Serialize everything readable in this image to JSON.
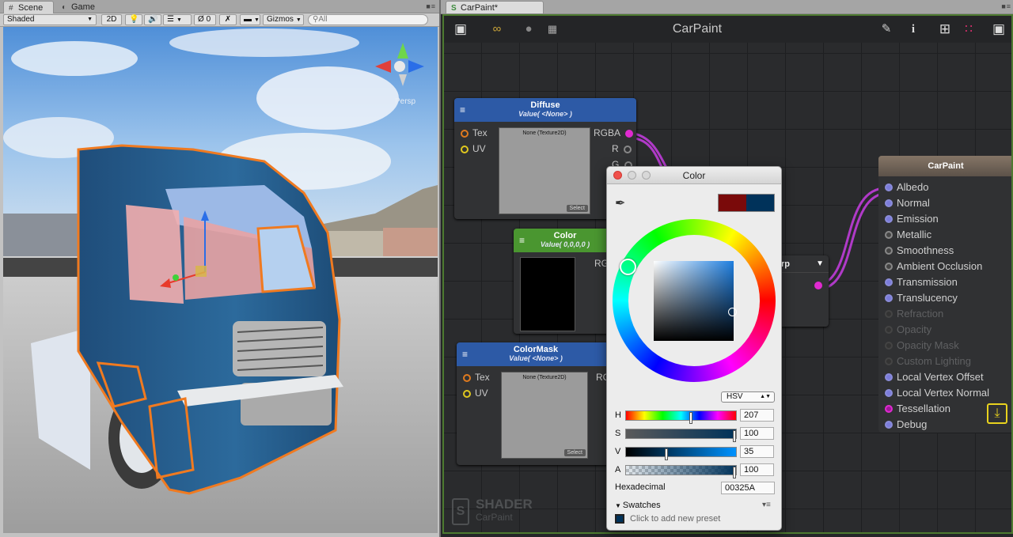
{
  "scene_window": {
    "tabs": [
      {
        "label": "Scene",
        "icon": "grid-icon"
      },
      {
        "label": "Game",
        "icon": "pacman-icon"
      }
    ],
    "toolbar": {
      "shading_mode": "Shaded",
      "mode_2d": "2D",
      "hidden_count": "0",
      "gizmos_label": "Gizmos",
      "search_placeholder": "All"
    },
    "gizmo_label": "Persp"
  },
  "shader_window": {
    "tab_label": "CarPaint*",
    "canvas_title": "CarPaint",
    "nodes": {
      "diffuse": {
        "title": "Diffuse",
        "subtitle": "Value( <None> )",
        "inputs": [
          "Tex",
          "UV"
        ],
        "outputs": [
          "RGBA",
          "R",
          "G"
        ],
        "preview_caption": "None (Texture2D)",
        "select_label": "Select"
      },
      "color": {
        "title": "Color",
        "subtitle": "Value( 0,0,0,0 )",
        "output_partial": "RGB"
      },
      "colormask": {
        "title": "ColorMask",
        "subtitle": "Value( <None> )",
        "inputs": [
          "Tex",
          "UV"
        ],
        "output_partial": "RG",
        "preview_caption": "None (Texture2D)",
        "select_label": "Select"
      },
      "hidden_node_partial_title": "rp"
    },
    "output_node": {
      "title": "CarPaint",
      "inputs": [
        {
          "label": "Albedo",
          "active": true,
          "color": "#7b7cdb"
        },
        {
          "label": "Normal",
          "active": true,
          "color": "#7b7cdb"
        },
        {
          "label": "Emission",
          "active": true,
          "color": "#7b7cdb"
        },
        {
          "label": "Metallic",
          "active": true,
          "color": "#6b6b6b"
        },
        {
          "label": "Smoothness",
          "active": true,
          "color": "#6b6b6b"
        },
        {
          "label": "Ambient Occlusion",
          "active": true,
          "color": "#6b6b6b"
        },
        {
          "label": "Transmission",
          "active": true,
          "color": "#7b7cdb"
        },
        {
          "label": "Translucency",
          "active": true,
          "color": "#7b7cdb"
        },
        {
          "label": "Refraction",
          "active": false,
          "color": "#4a4a4a"
        },
        {
          "label": "Opacity",
          "active": false,
          "color": "#4a4a4a"
        },
        {
          "label": "Opacity Mask",
          "active": false,
          "color": "#4a4a4a"
        },
        {
          "label": "Custom Lighting",
          "active": false,
          "color": "#4a4a4a"
        },
        {
          "label": "Local Vertex Offset",
          "active": true,
          "color": "#7b7cdb"
        },
        {
          "label": "Local Vertex Normal",
          "active": true,
          "color": "#7b7cdb"
        },
        {
          "label": "Tessellation",
          "active": true,
          "color": "#d020c0"
        },
        {
          "label": "Debug",
          "active": true,
          "color": "#7b7cdb"
        }
      ]
    },
    "logo": {
      "line1": "SHADER",
      "line2": "CarPaint"
    }
  },
  "color_picker": {
    "title": "Color",
    "mode": "HSV",
    "sliders": [
      {
        "label": "H",
        "value": "207",
        "fraction": 0.575
      },
      {
        "label": "S",
        "value": "100",
        "fraction": 1.0
      },
      {
        "label": "V",
        "value": "35",
        "fraction": 0.35
      },
      {
        "label": "A",
        "value": "100",
        "fraction": 1.0
      }
    ],
    "hex_label": "Hexadecimal",
    "hex_value": "00325A",
    "swatches_label": "Swatches",
    "add_preset_label": "Click to add new preset",
    "old_color": "#7a0a0a",
    "new_color": "#00325A"
  }
}
